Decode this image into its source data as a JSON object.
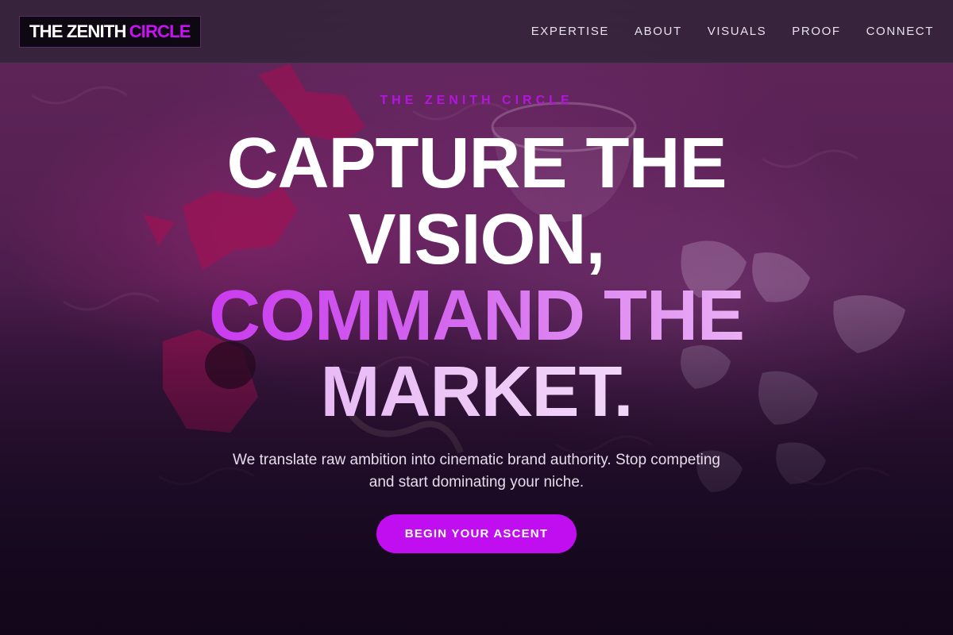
{
  "header": {
    "logo": {
      "text": "THE ZENITH",
      "accent": "CIRCLE"
    },
    "nav": [
      "EXPERTISE",
      "ABOUT",
      "VISUALS",
      "PROOF",
      "CONNECT"
    ]
  },
  "hero": {
    "eyebrow": "THE ZENITH CIRCLE",
    "headline": {
      "line1": "CAPTURE THE",
      "line2": "VISION,",
      "line3": "COMMAND THE",
      "line4": "MARKET."
    },
    "subtext": "We translate raw ambition into cinematic brand authority. Stop competing and start dominating your niche.",
    "cta": "BEGIN YOUR ASCENT"
  },
  "colors": {
    "accent": "#c10ef0",
    "header_bg": "#34243a",
    "page_bg": "#1a0a24"
  }
}
